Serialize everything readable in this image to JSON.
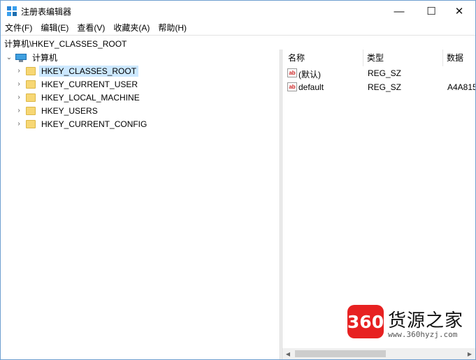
{
  "window": {
    "title": "注册表编辑器",
    "minimize_glyph": "—",
    "maximize_glyph": "☐",
    "close_glyph": "✕"
  },
  "menu": [
    "文件(F)",
    "编辑(E)",
    "查看(V)",
    "收藏夹(A)",
    "帮助(H)"
  ],
  "address": "计算机\\HKEY_CLASSES_ROOT",
  "tree": {
    "root_label": "计算机",
    "root_icon": "computer-icon",
    "expanded_glyph": "⌄",
    "collapsed_glyph": "›",
    "items": [
      {
        "label": "HKEY_CLASSES_ROOT",
        "selected": true
      },
      {
        "label": "HKEY_CURRENT_USER",
        "selected": false
      },
      {
        "label": "HKEY_LOCAL_MACHINE",
        "selected": false
      },
      {
        "label": "HKEY_USERS",
        "selected": false
      },
      {
        "label": "HKEY_CURRENT_CONFIG",
        "selected": false
      }
    ]
  },
  "list": {
    "columns": [
      "名称",
      "类型",
      "数据"
    ],
    "rows": [
      {
        "name": "(默认)",
        "type": "REG_SZ",
        "data": ""
      },
      {
        "name": "default",
        "type": "REG_SZ",
        "data": "A4A815"
      }
    ]
  },
  "watermark": {
    "badge": "360",
    "title": "货源之家",
    "url": "www.360hyzj.com",
    "badge_color": "#e72121"
  },
  "colors": {
    "selection": "#cce8ff",
    "folder": "#f7d774"
  }
}
